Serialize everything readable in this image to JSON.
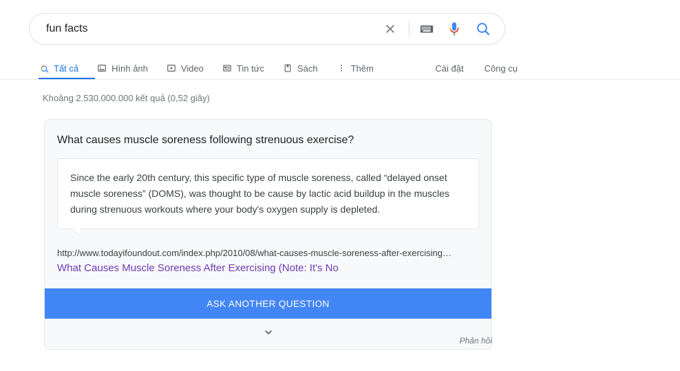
{
  "search": {
    "query": "fun facts",
    "placeholder": "",
    "clear_label": "Clear",
    "keyboard_label": "Search by keyboard",
    "voice_label": "Search by voice",
    "submit_label": "Google Search"
  },
  "tabs": {
    "items": [
      {
        "label": "Tất cả",
        "icon": "google-search-icon",
        "active": true
      },
      {
        "label": "Hình ảnh",
        "icon": "image-icon",
        "active": false
      },
      {
        "label": "Video",
        "icon": "video-icon",
        "active": false
      },
      {
        "label": "Tin tức",
        "icon": "news-icon",
        "active": false
      },
      {
        "label": "Sách",
        "icon": "book-icon",
        "active": false
      },
      {
        "label": "Thêm",
        "icon": "more-vertical-icon",
        "active": false
      }
    ],
    "right_items": [
      {
        "label": "Cài đặt"
      },
      {
        "label": "Công cụ"
      }
    ]
  },
  "result_stats": "Khoảng 2.530.000.000 kết quả (0,52 giây)",
  "card": {
    "question": "What causes muscle soreness following strenuous exercise?",
    "answer": "Since the early 20th century, this specific type of muscle soreness, called “delayed onset muscle soreness” (DOMS), was thought to be cause by lactic acid buildup in the muscles during strenuous workouts where your body's oxygen supply is depleted.",
    "source_url": "http://www.todayifoundout.com/index.php/2010/08/what-causes-muscle-soreness-after-exercising…",
    "source_title": "What Causes Muscle Soreness After Exercising (Note: It's No",
    "ask_button": "ASK ANOTHER QUESTION",
    "expand_label": "Show more"
  },
  "feedback": "Phản hồi",
  "colors": {
    "accent_blue": "#1a73e8",
    "button_blue": "#4285f4",
    "link_purple": "#6c3cb4",
    "card_bg": "#f8f9fa",
    "muted_text": "#70757a"
  }
}
